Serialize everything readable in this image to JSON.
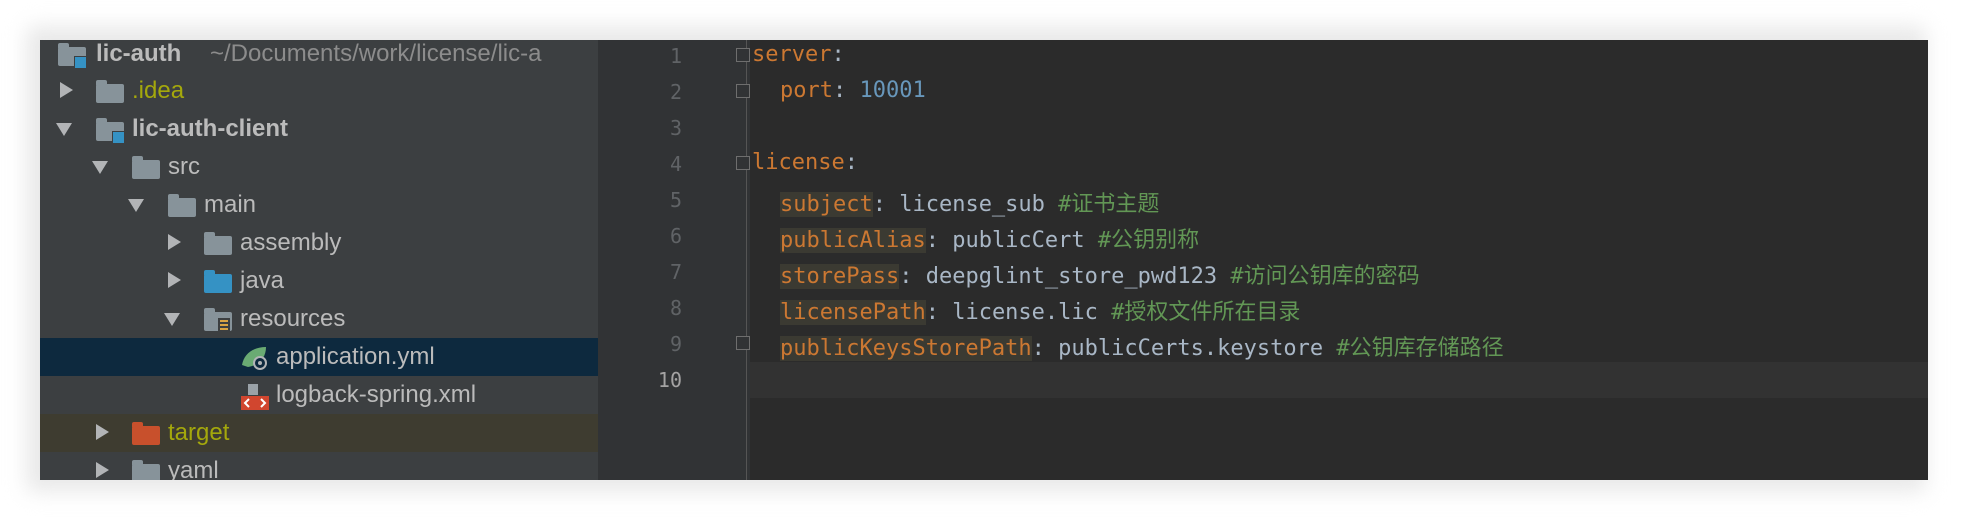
{
  "project": {
    "root": {
      "name": "lic-auth",
      "path": "~/Documents/work/license/lic-a"
    },
    "items": [
      {
        "label": ".idea"
      },
      {
        "label": "lic-auth-client"
      },
      {
        "label": "src"
      },
      {
        "label": "main"
      },
      {
        "label": "assembly"
      },
      {
        "label": "java"
      },
      {
        "label": "resources"
      },
      {
        "label": "application.yml"
      },
      {
        "label": "logback-spring.xml"
      },
      {
        "label": "target"
      },
      {
        "label": "yaml"
      }
    ]
  },
  "editor": {
    "line_numbers": [
      "1",
      "2",
      "3",
      "4",
      "5",
      "6",
      "7",
      "8",
      "9",
      "10"
    ],
    "lines": [
      {
        "key": "server",
        "sep": ":"
      },
      {
        "key": "port",
        "sep": ": ",
        "value": "10001"
      },
      {},
      {
        "key": "license",
        "sep": ":"
      },
      {
        "key": "subject",
        "sep": ": ",
        "value": "license_sub",
        "comment": "#证书主题"
      },
      {
        "key": "publicAlias",
        "sep": ": ",
        "value": "publicCert",
        "comment": "#公钥别称"
      },
      {
        "key": "storePass",
        "sep": ": ",
        "value": "deepglint_store_pwd123",
        "comment": "#访问公钥库的密码"
      },
      {
        "key": "licensePath",
        "sep": ": ",
        "value": "license.lic",
        "comment": "#授权文件所在目录"
      },
      {
        "key": "publicKeysStorePath",
        "sep": ": ",
        "value": "publicCerts.keystore",
        "comment": "#公钥库存储路径"
      }
    ]
  },
  "colors": {
    "panel": "#3c3f41",
    "editor": "#2b2b2b",
    "key": "#cc7832",
    "number": "#6897bb",
    "comment": "#629755",
    "selected_row": "#0d293e"
  }
}
